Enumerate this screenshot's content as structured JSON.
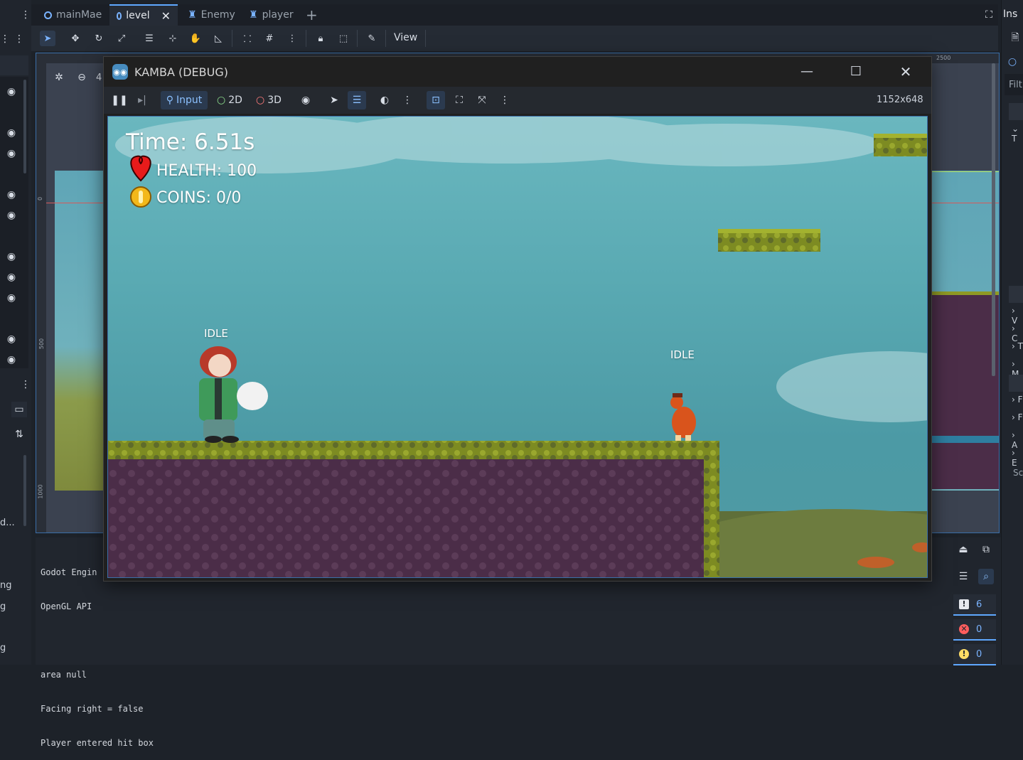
{
  "editor": {
    "tabs": [
      {
        "label": "mainMae",
        "icon": "circle-node-icon"
      },
      {
        "label": "level",
        "icon": "circle-node-icon",
        "active": true
      },
      {
        "label": "Enemy",
        "icon": "character-node-icon"
      },
      {
        "label": "player",
        "icon": "character-node-icon"
      }
    ],
    "view_menu": "View",
    "inspector_label": "Ins",
    "filter_label": "Filt",
    "right_letters": [
      "T",
      "V",
      "C",
      "T",
      "M",
      "F",
      "F",
      "A",
      "E"
    ],
    "right_sc": "Sc",
    "ruler_top": "2500",
    "ruler_left": [
      "0",
      "500",
      "1000"
    ],
    "viewport_zoom_partial": "4",
    "left_fragments": [
      "d...",
      "ng",
      "g",
      "g"
    ]
  },
  "console": {
    "lines": [
      "Godot Engin",
      "OpenGL API ",
      "",
      "area null",
      "Facing right = false",
      "Player entered hit box"
    ]
  },
  "log_filters": [
    {
      "name": "messages",
      "count": "6",
      "color": "#e6e9ee"
    },
    {
      "name": "errors",
      "count": "0",
      "color": "#ff5d5d"
    },
    {
      "name": "warnings",
      "count": "0",
      "color": "#ffdd65"
    }
  ],
  "game_window": {
    "title": "KAMBA (DEBUG)",
    "toolbar": {
      "input_label": "Input",
      "mode_2d": "2D",
      "mode_3d": "3D",
      "resolution": "1152x648"
    },
    "hud": {
      "time": "Time: 6.51s",
      "health": "HEALTH: 100",
      "coins": "COINS: 0/0"
    },
    "player_state": "IDLE",
    "enemy_state": "IDLE"
  },
  "colors": {
    "accent": "#5fa8ff",
    "sky": "#4fa6ad",
    "ground_dirt": "#4b2d48",
    "grass": "#8f9a24"
  }
}
